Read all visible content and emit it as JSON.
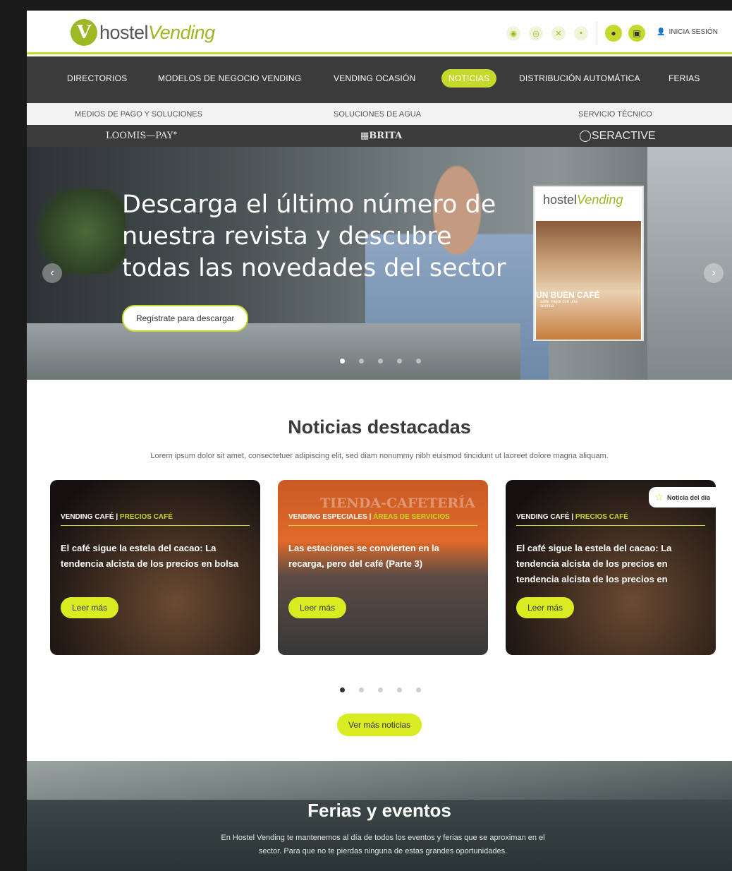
{
  "header": {
    "logo_text_a": "hostel",
    "logo_text_b": "Vending",
    "social_icons": [
      "instagram-icon",
      "camera-icon",
      "x-icon",
      "linkedin-icon"
    ],
    "login_label": "INICIA SESIÓN"
  },
  "nav": {
    "items": [
      "DIRECTORIOS",
      "MODELOS DE NEGOCIO VENDING",
      "VENDING OCASIÓN",
      "NOTICIAS",
      "DISTRIBUCIÓN AUTOMÁTICA",
      "FERIAS"
    ],
    "active": "NOTICIAS"
  },
  "subnav": {
    "items": [
      "MEDIOS DE PAGO Y SOLUCIONES",
      "SOLUCIONES DE AGUA",
      "SERVICIO TÉCNICO"
    ],
    "brands": [
      "LOOMIS—PAY°",
      "BRITA",
      "SERACTIVE"
    ]
  },
  "hero": {
    "title": "Descarga el último número de nuestra revista y descubre todas las novedades del sector",
    "cta": "Regístrate para descargar",
    "magazine_logo_a": "hostel",
    "magazine_logo_b": "Vending",
    "magazine_headline": "UN BUEN CAFÉ",
    "magazine_sub": "sabe mejor con una sonrisa"
  },
  "news": {
    "title": "Noticias destacadas",
    "description": "Lorem ipsum dolor sit amet, consectetuer adipiscing elit, sed diam nonummy nibh euismod tincidunt ut laoreet dolore magna aliquam.",
    "cards": [
      {
        "tag1": "VENDING CAFÉ",
        "tag2": "PRECIOS CAFÉ",
        "title": "El café sigue la estela del cacao: La tendencia alcista de los precios en bolsa",
        "button": "Leer más"
      },
      {
        "tag1": "VENDING ESPECIALES",
        "tag2": "ÁREAS DE SERVICIOS",
        "title": "Las estaciones se convierten en la recarga, pero del café (Parte 3)",
        "button": "Leer más",
        "sign": "TIENDA-CAFETERÍA"
      },
      {
        "tag1": "VENDING CAFÉ",
        "tag2": "PRECIOS CAFÉ",
        "title": "El café sigue la estela del cacao: La tendencia alcista de los precios en tendencia alcista de los precios en",
        "button": "Leer más",
        "badge": "Noticia del día"
      }
    ],
    "more_button": "Ver más noticias"
  },
  "ferias": {
    "title": "Ferias y eventos",
    "description": "En Hostel Vending te mantenemos al día de todos los eventos y ferias que se aproximan en el sector. Para que no te pierdas ninguna de estas grandes oportunidades."
  },
  "colors": {
    "accent": "#c5d92d",
    "button_lime": "#d8ec21",
    "nav_bg": "#3b3b3b"
  }
}
